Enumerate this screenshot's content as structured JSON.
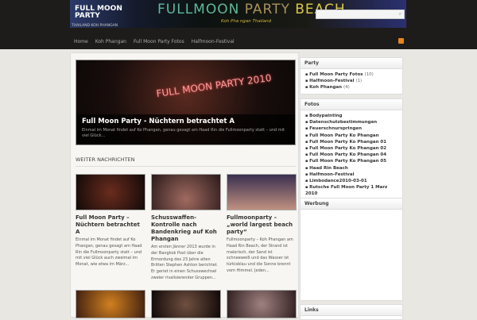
{
  "site": {
    "title": "FULL MOON PARTY",
    "description": "THAILAND KOH PHANGAN",
    "banner_title": [
      "FULLMOON",
      "PARTY",
      "BEACH"
    ],
    "banner_subtitle": "Koh Pha ngan Thailand"
  },
  "search": {
    "placeholder": "",
    "icon": "search-icon"
  },
  "nav": {
    "items": [
      "Home",
      "Koh Phangan",
      "Full Moon Party Fotos",
      "Halfmoon-Festival"
    ],
    "rss_icon": "rss-icon"
  },
  "feature": {
    "image_text": "FULL MOON PARTY 2010",
    "title": "Full Moon Party - Nüchtern betrachtet A",
    "excerpt": "Einmal im Monat findet auf Ko Phangan, genau gesagt am Haad Rin die Fullmoonparty statt – und mit viel Glück..."
  },
  "more_heading": "WEITER NACHRICHTEN",
  "posts": [
    {
      "title": "Full Moon Party – Nüchtern betrachtet A",
      "excerpt": "Einmal im Monat findet auf Ko Phangan, genau gesagt am Haad Rin die Fullmoonparty statt – und mit viel Glück auch zweimal im Monat, wie etwa im März..."
    },
    {
      "title": "Schusswaffen-Kontrolle nach Bandenkrieg auf Koh Phangan",
      "excerpt": "Am ersten Jänner 2013 wurde in der Bangkok Post über die Ermordung des 23 Jahre alten Britten Stephen Ashton berichtet. Er geriet in einen Schusswechsel zweier rivalisierender Gruppen..."
    },
    {
      "title": "Fullmoonparty – „world largest beach party“",
      "excerpt": "Fullmoonparty – Koh Phangan am Haad Rin Beach, der Strand ist malerisch, der Sand ist schneeweiß und das Wasser ist türkisblau und die Sonne brennt vom Himmel. Jeden..."
    }
  ],
  "sidebar": {
    "party": {
      "title": "Party",
      "items": [
        {
          "label": "Full Moon Party Fotos",
          "count": "(10)"
        },
        {
          "label": "Halfmoon-Festival",
          "count": "(1)"
        },
        {
          "label": "Koh Phangan",
          "count": "(4)"
        }
      ]
    },
    "fotos": {
      "title": "Fotos",
      "items": [
        "Bodypainting",
        "Datenschutzbestimmungen",
        "Feuerschnurspringen",
        "Full Moon Party Ko Phangan",
        "Full Moon Party Ko Phangan 01",
        "Full Moon Party Ko Phangan 02",
        "Full Moon Party Ko Phangan 04",
        "Full Moon Party Ko Phangan 05",
        "Haad Rin Beach",
        "Halfmoon-Festival",
        "Limbodance2010-03-01",
        "Rutsche Full Moon Party 1 Marz 2010"
      ]
    },
    "werbung": {
      "title": "Werbung"
    },
    "links": {
      "title": "Links"
    }
  }
}
